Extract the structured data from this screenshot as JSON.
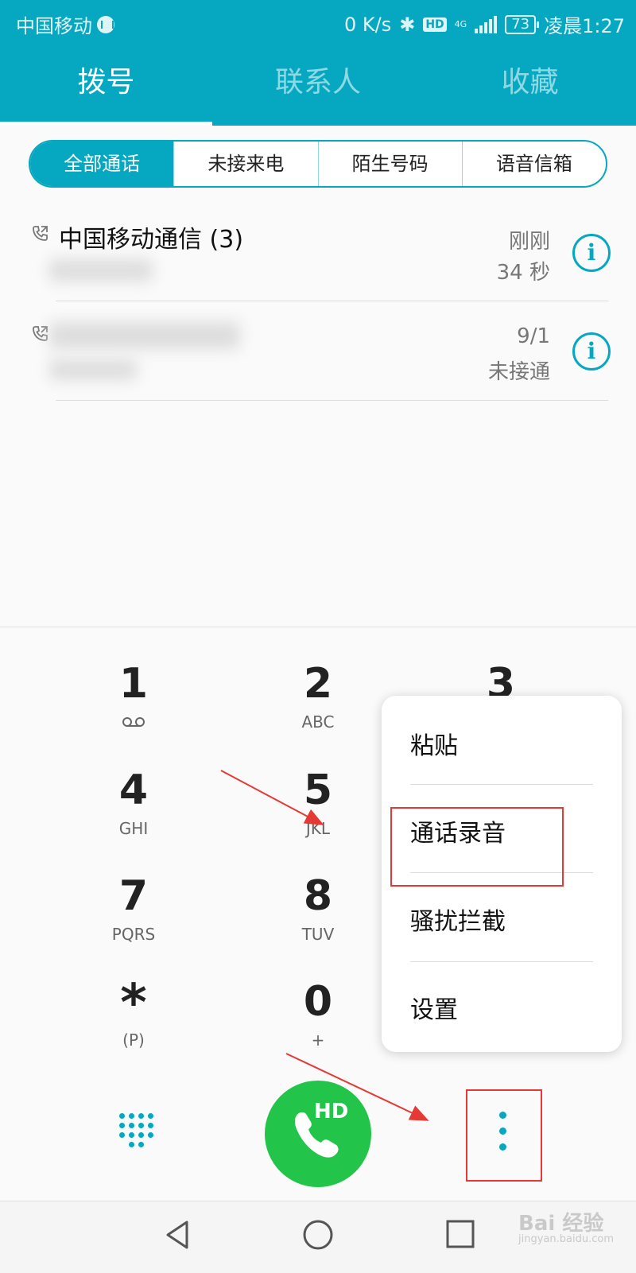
{
  "status_bar": {
    "carrier": "中国移动",
    "speed": "0 K/s",
    "hd_label": "HD",
    "network": "4G",
    "battery": "73",
    "time": "凌晨1:27"
  },
  "top_tabs": [
    {
      "label": "拨号",
      "active": true
    },
    {
      "label": "联系人",
      "active": false
    },
    {
      "label": "收藏",
      "active": false
    }
  ],
  "filter_segments": [
    "全部通话",
    "未接来电",
    "陌生号码",
    "语音信箱"
  ],
  "calls": [
    {
      "name": "中国移动通信 (3)",
      "time": "刚刚",
      "detail": "34 秒"
    },
    {
      "name": "",
      "time": "9/1",
      "detail": "未接通"
    }
  ],
  "dialpad": {
    "keys": [
      {
        "digit": "1",
        "letters": "oo"
      },
      {
        "digit": "2",
        "letters": "ABC"
      },
      {
        "digit": "3",
        "letters": ""
      },
      {
        "digit": "4",
        "letters": "GHI"
      },
      {
        "digit": "5",
        "letters": "JKL"
      },
      {
        "digit": "7",
        "letters": "PQRS"
      },
      {
        "digit": "8",
        "letters": "TUV"
      },
      {
        "digit": "*",
        "letters": "(P)"
      },
      {
        "digit": "0",
        "letters": "+"
      }
    ],
    "call_button_label": "HD"
  },
  "popup_menu": [
    "粘贴",
    "通话录音",
    "骚扰拦截",
    "设置"
  ],
  "watermark": {
    "brand": "Bai 经验",
    "url": "jingyan.baidu.com"
  },
  "colors": {
    "accent": "#06a7c0",
    "call_green": "#22c449",
    "annotation": "#e53935"
  }
}
